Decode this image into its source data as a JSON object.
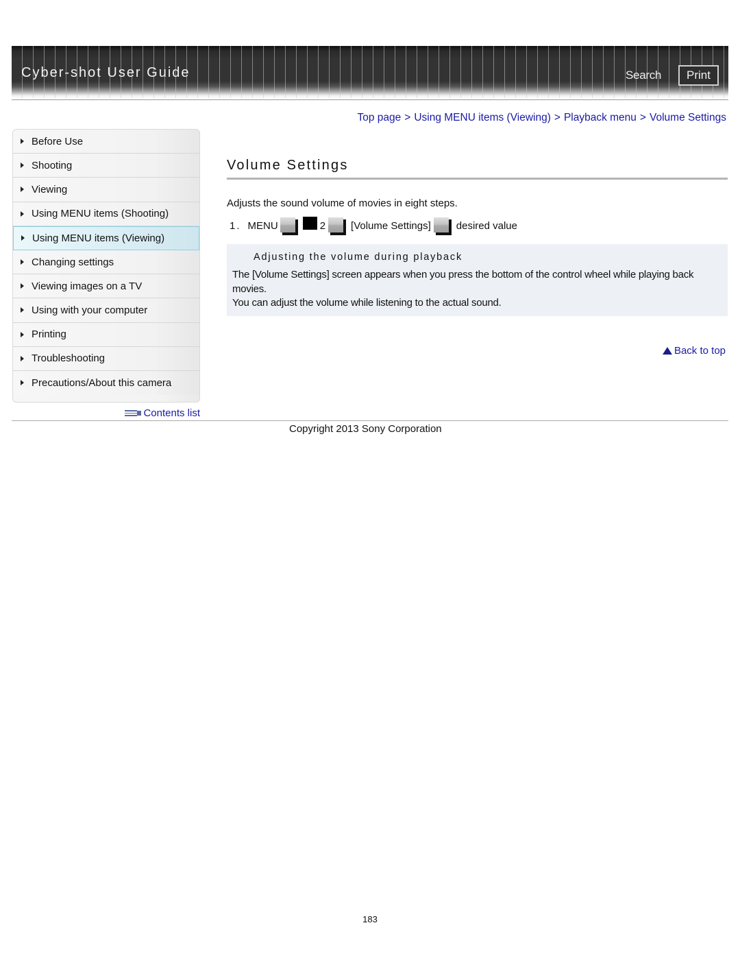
{
  "header": {
    "title": "Cyber-shot User Guide",
    "search_label": "Search",
    "print_label": "Print"
  },
  "breadcrumb": {
    "items": [
      "Top page",
      "Using MENU items (Viewing)",
      "Playback menu",
      "Volume Settings"
    ],
    "separator": ">"
  },
  "sidebar": {
    "items": [
      {
        "label": "Before Use",
        "active": false
      },
      {
        "label": "Shooting",
        "active": false
      },
      {
        "label": "Viewing",
        "active": false
      },
      {
        "label": "Using MENU items (Shooting)",
        "active": false
      },
      {
        "label": "Using MENU items (Viewing)",
        "active": true
      },
      {
        "label": "Changing settings",
        "active": false
      },
      {
        "label": "Viewing images on a TV",
        "active": false
      },
      {
        "label": "Using with your computer",
        "active": false
      },
      {
        "label": "Printing",
        "active": false
      },
      {
        "label": "Troubleshooting",
        "active": false
      },
      {
        "label": "Precautions/About this camera",
        "active": false
      }
    ],
    "contents_link": "Contents list"
  },
  "main": {
    "title": "Volume Settings",
    "intro": "Adjusts the sound volume of movies in eight steps.",
    "step": {
      "number": "1.",
      "menu": "MENU",
      "tab_number": "2",
      "item": "[Volume Settings]",
      "final": "desired value"
    },
    "note": {
      "title": "Adjusting the volume during playback",
      "lines": [
        "The [Volume Settings] screen appears when you press the bottom of the control wheel while playing back movies.",
        "You can adjust the volume while listening to the actual sound."
      ]
    },
    "back_to_top": "Back to top"
  },
  "footer": {
    "copyright": "Copyright 2013 Sony Corporation",
    "page_number": "183"
  },
  "colors": {
    "link": "#1a1aa6",
    "note_bg": "#edf0f5",
    "active_nav_bg": "#d9eef4",
    "active_nav_border": "#8fd0e3"
  }
}
